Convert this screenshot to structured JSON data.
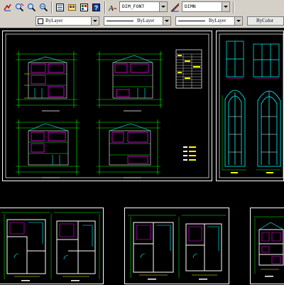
{
  "toolbar1": {
    "text_style_value": "DIM_FONT",
    "dim_style_value": "DIMN"
  },
  "toolbar2": {
    "color_value": "ByLayer",
    "linetype_value": "ByLayer",
    "lineweight_value": "ByLayer",
    "plotstyle_value": "ByColor"
  },
  "drawing": {
    "background": "#000000",
    "line_colors": [
      "#00ff00",
      "#ffffff",
      "#ffff00",
      "#00ffff",
      "#ff00ff",
      "#ff0000"
    ]
  }
}
